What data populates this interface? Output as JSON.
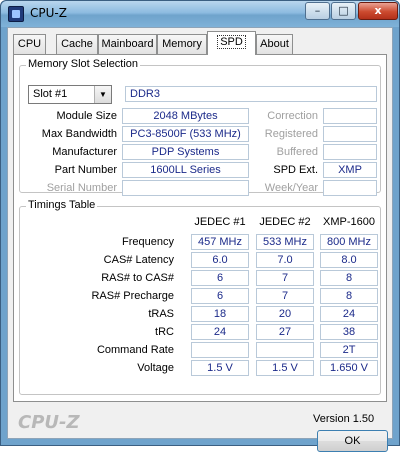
{
  "window": {
    "title": "CPU-Z",
    "min_glyph": "–",
    "max_glyph": "□",
    "close_glyph": "x"
  },
  "tabs": [
    {
      "label": "CPU",
      "active": false
    },
    {
      "label": "Cache",
      "active": false
    },
    {
      "label": "Mainboard",
      "active": false
    },
    {
      "label": "Memory",
      "active": false
    },
    {
      "label": "SPD",
      "active": true
    },
    {
      "label": "About",
      "active": false
    }
  ],
  "slot_group": {
    "title": "Memory Slot Selection",
    "slot_selected": "Slot #1",
    "memory_type": "DDR3",
    "module_size_label": "Module Size",
    "module_size": "2048 MBytes",
    "max_bandwidth_label": "Max Bandwidth",
    "max_bandwidth": "PC3-8500F (533 MHz)",
    "manufacturer_label": "Manufacturer",
    "manufacturer": "PDP Systems",
    "part_number_label": "Part Number",
    "part_number": "1600LL Series",
    "serial_number_label": "Serial Number",
    "serial_number": "",
    "correction_label": "Correction",
    "correction": "",
    "registered_label": "Registered",
    "registered": "",
    "buffered_label": "Buffered",
    "buffered": "",
    "spd_ext_label": "SPD Ext.",
    "spd_ext": "XMP",
    "week_year_label": "Week/Year",
    "week_year": ""
  },
  "timings": {
    "title": "Timings Table",
    "columns": [
      "JEDEC #1",
      "JEDEC #2",
      "XMP-1600"
    ],
    "rows": [
      {
        "label": "Frequency",
        "values": [
          "457 MHz",
          "533 MHz",
          "800 MHz"
        ]
      },
      {
        "label": "CAS# Latency",
        "values": [
          "6.0",
          "7.0",
          "8.0"
        ]
      },
      {
        "label": "RAS# to CAS#",
        "values": [
          "6",
          "7",
          "8"
        ]
      },
      {
        "label": "RAS# Precharge",
        "values": [
          "6",
          "7",
          "8"
        ]
      },
      {
        "label": "tRAS",
        "values": [
          "18",
          "20",
          "24"
        ]
      },
      {
        "label": "tRC",
        "values": [
          "24",
          "27",
          "38"
        ]
      },
      {
        "label": "Command Rate",
        "values": [
          "",
          "",
          "2T"
        ]
      },
      {
        "label": "Voltage",
        "values": [
          "1.5 V",
          "1.5 V",
          "1.650 V"
        ]
      }
    ]
  },
  "footer": {
    "version": "Version 1.50",
    "brand": "CPU-Z",
    "ok_label": "OK"
  },
  "colors": {
    "value_text": "#1b2a8a",
    "frame_blue": "#6fa3cc",
    "close_red": "#cc4a2f"
  }
}
